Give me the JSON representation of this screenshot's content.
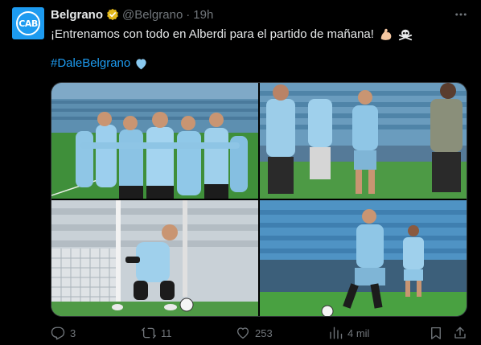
{
  "post": {
    "author_name": "Belgrano",
    "author_handle": "@Belgrano",
    "separator": "·",
    "timestamp": "19h",
    "avatar_text": "CAB",
    "text": "¡Entrenamos con todo en Alberdi para el partido de mañana!",
    "hashtag": "#DaleBelgrano",
    "emojis": [
      "flexed-biceps",
      "skull-and-crossbones",
      "light-blue-heart"
    ]
  },
  "media": {
    "photo_count": 4,
    "photos": [
      "team-huddle",
      "players-standing-on-pitch",
      "goalkeeper-crouching-with-ball",
      "player-dribbling-ball"
    ]
  },
  "actions": {
    "replies": "3",
    "reposts": "11",
    "likes": "253",
    "views": "4 mil"
  },
  "colors": {
    "background": "#000000",
    "text_primary": "#e7e9ea",
    "text_secondary": "#71767b",
    "link": "#1d9bf0",
    "verified_gold": "#e2b719",
    "avatar_bg": "#1d9bf0"
  }
}
